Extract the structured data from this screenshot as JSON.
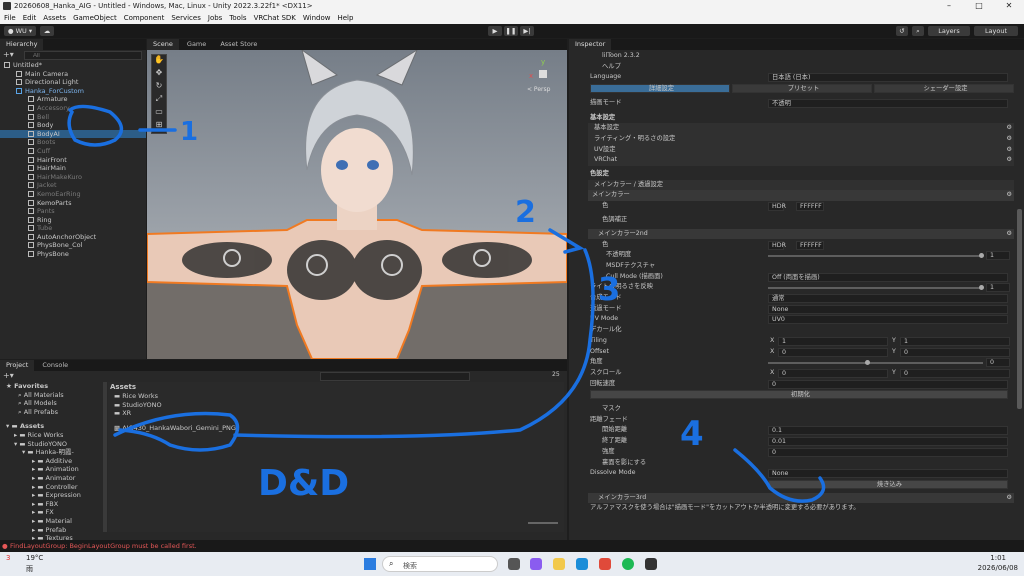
{
  "window": {
    "title": "20260608_Hanka_AIG - Untitled - Windows, Mac, Linux - Unity 2022.3.22f1* <DX11>",
    "controls": [
      "–",
      "□",
      "✕"
    ]
  },
  "menu": [
    "File",
    "Edit",
    "Assets",
    "GameObject",
    "Component",
    "Services",
    "Jobs",
    "Tools",
    "VRChat SDK",
    "Window",
    "Help"
  ],
  "toolbar": {
    "account": "● WU ▾",
    "cloud": "☁",
    "play": "▶",
    "pause": "❚❚",
    "step": "▶|",
    "layers": "Layers",
    "layout": "Layout"
  },
  "hierarchy": {
    "tab": "Hierarchy",
    "search_placeholder": "All",
    "items": [
      {
        "label": "Untitled*",
        "indent": 0,
        "style": "root"
      },
      {
        "label": "Main Camera",
        "indent": 1,
        "style": "normal"
      },
      {
        "label": "Directional Light",
        "indent": 1,
        "style": "normal"
      },
      {
        "label": "Hanka_ForCustom",
        "indent": 1,
        "style": "prefab"
      },
      {
        "label": "Armature",
        "indent": 2,
        "style": "normal"
      },
      {
        "label": "Accessory",
        "indent": 2,
        "style": "dim"
      },
      {
        "label": "Bell",
        "indent": 2,
        "style": "dim"
      },
      {
        "label": "Body",
        "indent": 2,
        "style": "normal"
      },
      {
        "label": "BodyAI",
        "indent": 2,
        "style": "sel"
      },
      {
        "label": "Boots",
        "indent": 2,
        "style": "dim"
      },
      {
        "label": "Cuff",
        "indent": 2,
        "style": "dim"
      },
      {
        "label": "HairFront",
        "indent": 2,
        "style": "normal"
      },
      {
        "label": "HairMain",
        "indent": 2,
        "style": "normal"
      },
      {
        "label": "HairMakeKuro",
        "indent": 2,
        "style": "dim"
      },
      {
        "label": "Jacket",
        "indent": 2,
        "style": "dim"
      },
      {
        "label": "KemoEarRing",
        "indent": 2,
        "style": "dim"
      },
      {
        "label": "KemoParts",
        "indent": 2,
        "style": "normal"
      },
      {
        "label": "Pants",
        "indent": 2,
        "style": "dim"
      },
      {
        "label": "Ring",
        "indent": 2,
        "style": "normal"
      },
      {
        "label": "Tube",
        "indent": 2,
        "style": "dim"
      },
      {
        "label": "AutoAnchorObject",
        "indent": 2,
        "style": "normal"
      },
      {
        "label": "PhysBone_Col",
        "indent": 2,
        "style": "normal"
      },
      {
        "label": "PhysBone",
        "indent": 2,
        "style": "normal"
      }
    ]
  },
  "scene": {
    "tabs": [
      "Scene",
      "Game",
      "Asset Store"
    ],
    "persp": "< Persp",
    "gizmo_axes": [
      "y",
      "x"
    ]
  },
  "project": {
    "tabs": [
      "Project",
      "Console"
    ],
    "favorites_label": "Favorites",
    "favorites": [
      "All Materials",
      "All Models",
      "All Prefabs"
    ],
    "assets_label": "Assets",
    "folders": [
      "Rice Works",
      "StudioYONO",
      "Hanka-明霞-",
      "Additive",
      "Animation",
      "Animator",
      "Controller",
      "Expression",
      "FBX",
      "FX",
      "Material",
      "Prefab",
      "Textures"
    ],
    "breadcrumb": "Assets",
    "files": [
      {
        "label": "Rice Works",
        "type": "folder"
      },
      {
        "label": "StudioYONO",
        "type": "folder"
      },
      {
        "label": "XR",
        "type": "folder"
      },
      {
        "label": "AIG430_HankaWabori_Gemini_PNG",
        "type": "image"
      }
    ],
    "count": "25"
  },
  "status": {
    "error": "FindLayoutGroup: BeginLayoutGroup must be called first."
  },
  "inspector": {
    "tab": "Inspector",
    "shader_title": "lilToon 2.3.2",
    "help": "ヘルプ",
    "language_label": "Language",
    "language_value": "日本語 (日本)",
    "mode_tabs": [
      "詳細設定",
      "プリセット",
      "シェーダー設定"
    ],
    "render_mode_label": "描画モード",
    "render_mode_value": "不透明",
    "basic_label": "基本設定",
    "sections": [
      "基本設定",
      "ライティング・明るさの設定",
      "UV設定",
      "VRChat"
    ],
    "color_label": "色設定",
    "main_color_section": "メインカラー / 透過設定",
    "main_color_header": "メインカラー",
    "color_label_short": "色",
    "hdr": "HDR",
    "hex_value": "FFFFFF",
    "color_adjust": "色調補正",
    "main2nd_header": "メインカラー2nd",
    "main2nd_rows": [
      {
        "label": "不透明度",
        "value": "1"
      },
      {
        "label": "MSDFテクスチャ",
        "value": ""
      },
      {
        "label": "Cull Mode (描画面)",
        "value": "Off (両面を描画)"
      },
      {
        "label": "ライトの明るさを反映",
        "value": "1"
      },
      {
        "label": "合成モード",
        "value": "通常"
      },
      {
        "label": "透過モード",
        "value": "None"
      },
      {
        "label": "UV Mode",
        "value": "UV0"
      },
      {
        "label": "デカール化",
        "value": ""
      }
    ],
    "tiling_label": "Tiling",
    "tiling": {
      "x": "1",
      "y": "1"
    },
    "offset_label": "Offset",
    "offset": {
      "x": "0",
      "y": "0"
    },
    "angle_label": "角度",
    "angle_value": "0",
    "scroll_label": "スクロール",
    "scroll": {
      "x": "0",
      "y": "0"
    },
    "rotate_label": "回転速度",
    "rotate_value": "0",
    "reset_button": "初期化",
    "mask_label": "マスク",
    "distfade_label": "距離フェード",
    "distfade_rows": [
      {
        "label": "開始距離",
        "value": "0.1"
      },
      {
        "label": "終了距離",
        "value": "0.01"
      },
      {
        "label": "強度",
        "value": "0"
      },
      {
        "label": "裏面を影にする",
        "value": ""
      }
    ],
    "dissolve_label": "Dissolve Mode",
    "dissolve_value": "None",
    "bake_button": "焼き込み",
    "main3rd_header": "メインカラー3rd",
    "note": "アルファマスクを使う場合は\"描画モード\"をカットアウトか半透明に変更する必要があります。"
  },
  "annotations": {
    "n1": "1",
    "n2": "2",
    "n3": "3",
    "n4": "4",
    "dd": "D&D",
    "color": "#1a6fe0"
  },
  "taskbar": {
    "weather_temp": "19°C",
    "weather_desc": "雨",
    "search_placeholder": "検索",
    "time": "1:01",
    "date": "2026/06/08",
    "badge": "3"
  }
}
